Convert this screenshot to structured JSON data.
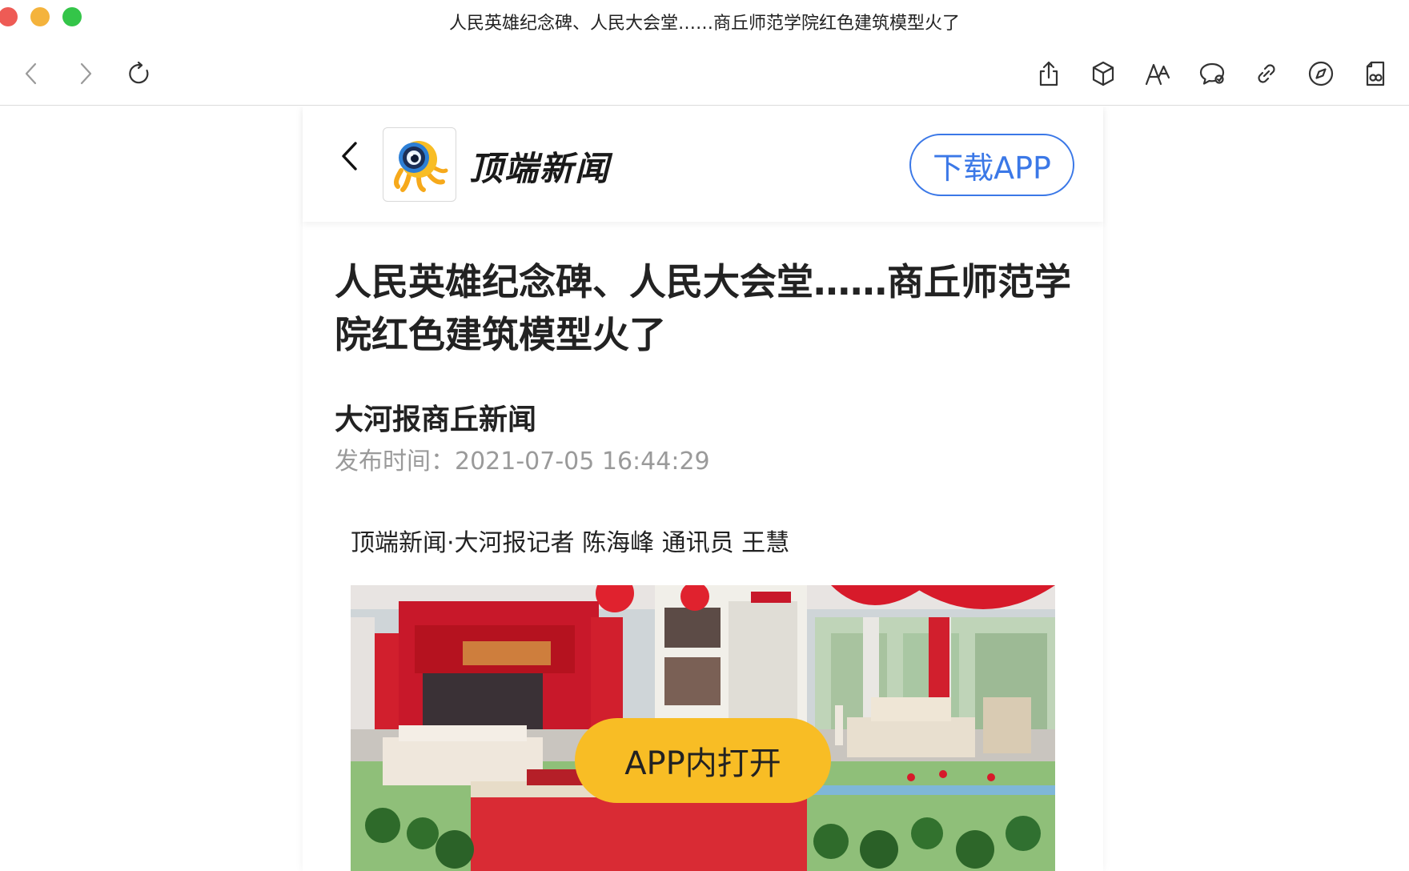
{
  "window": {
    "title": "人民英雄纪念碑、人民大会堂……商丘师范学院红色建筑模型火了"
  },
  "toolbar": {
    "icons": [
      "back-icon",
      "forward-icon",
      "reload-icon",
      "share-icon",
      "cube-icon",
      "text-size-icon",
      "chat-bubble-icon",
      "link-icon",
      "compass-icon",
      "reader-icon"
    ]
  },
  "header": {
    "brand": "顶端新闻",
    "download_label": "下载APP"
  },
  "article": {
    "title": "人民英雄纪念碑、人民大会堂……商丘师范学院红色建筑模型火了",
    "source": "大河报商丘新闻",
    "published_prefix": "发布时间：",
    "published_time": "2021-07-05 16:44:29",
    "byline": "顶端新闻·大河报记者 陈海峰 通讯员 王慧",
    "open_in_app_label": "APP内打开"
  },
  "colors": {
    "accent_blue": "#3b78e7",
    "open_app_yellow": "#f8bd25",
    "muted_gray": "#9a9a9a"
  }
}
